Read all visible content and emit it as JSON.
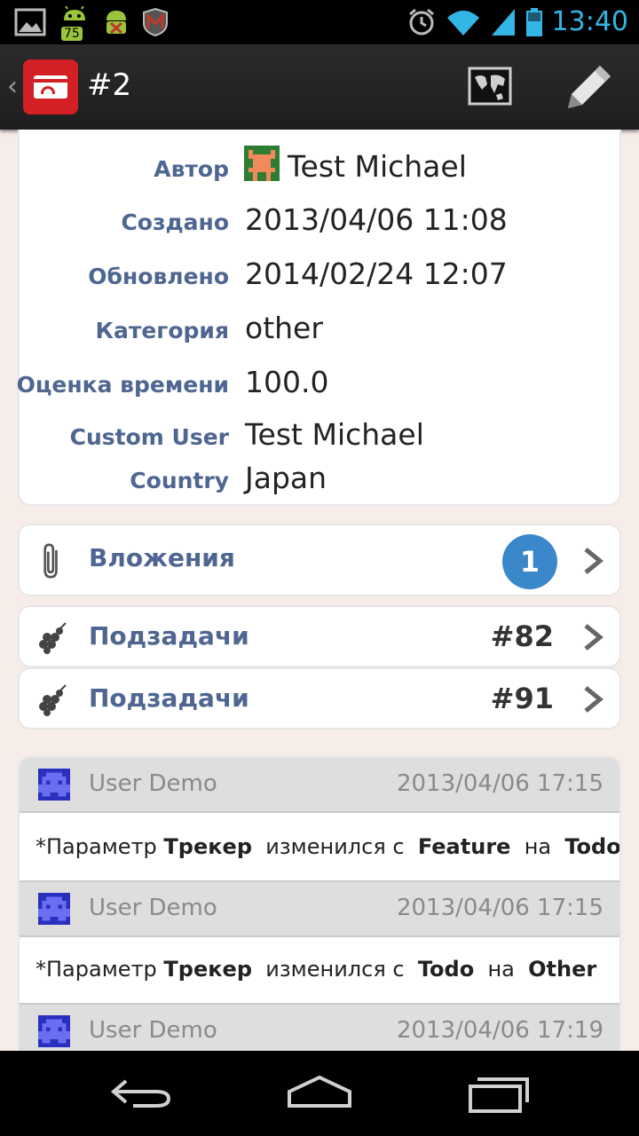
{
  "status_bar": {
    "time": "13:40",
    "notification_badge": "75",
    "icons": [
      "gallery-icon",
      "android-update-icon",
      "android-debug-icon",
      "mcafee-icon",
      "alarm-icon",
      "wifi-icon",
      "signal-icon",
      "battery-icon"
    ]
  },
  "action_bar": {
    "title": "#2",
    "icons": [
      "app-card-icon",
      "map-icon",
      "edit-pencil-icon"
    ]
  },
  "details": {
    "rows": [
      {
        "label": "Автор",
        "value": "Test Michael"
      },
      {
        "label": "Создано",
        "value": "2013/04/06 11:08"
      },
      {
        "label": "Обновлено",
        "value": "2014/02/24 12:07"
      },
      {
        "label": "Категория",
        "value": "other"
      },
      {
        "label": "Оценка времени",
        "value": "100.0"
      },
      {
        "label": "Custom User",
        "value": "Test Michael"
      },
      {
        "label": "Country",
        "value": "Japan"
      }
    ]
  },
  "attachments": {
    "label": "Вложения",
    "count": "1"
  },
  "subtasks": [
    {
      "label": "Подзадачи",
      "number": "#82"
    },
    {
      "label": "Подзадачи",
      "number": "#91"
    }
  ],
  "journal": [
    {
      "user": "User Demo",
      "date": "2013/04/06 17:15",
      "prefix": "*Параметр",
      "field": "Трекер",
      "mid1": "изменился с",
      "from": "Feature",
      "mid2": "на",
      "to": "Todo"
    },
    {
      "user": "User Demo",
      "date": "2013/04/06 17:15",
      "prefix": "*Параметр",
      "field": "Трекер",
      "mid1": "изменился с",
      "from": "Todo",
      "mid2": "на",
      "to": "Other"
    },
    {
      "user": "User Demo",
      "date": "2013/04/06 17:19"
    }
  ],
  "colors": {
    "accent_blue": "#33b5e5",
    "label_blue": "#4e6691",
    "badge_blue": "#3a87c9",
    "app_red": "#d32024",
    "page_bg": "#f7ede8"
  }
}
